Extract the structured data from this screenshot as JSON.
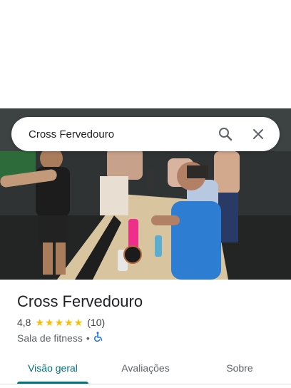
{
  "search": {
    "query": "Cross Fervedouro",
    "search_icon": "search-icon",
    "close_icon": "close-icon"
  },
  "place": {
    "name": "Cross Fervedouro",
    "rating": "4,8",
    "stars": 4.8,
    "reviews": "(10)",
    "category": "Sala de fitness",
    "separator": "•",
    "accessibility_icon": "wheelchair-icon"
  },
  "tabs": [
    {
      "label": "Visão geral",
      "active": true
    },
    {
      "label": "Avaliações",
      "active": false
    },
    {
      "label": "Sobre",
      "active": false
    }
  ],
  "colors": {
    "accent": "#00737d",
    "star": "#fbbc04",
    "accessibility": "#1a73e8"
  }
}
